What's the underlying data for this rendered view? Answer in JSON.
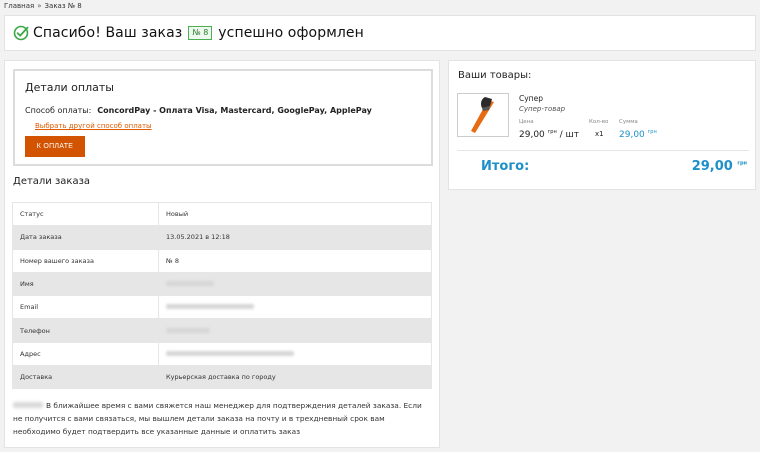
{
  "breadcrumb": {
    "home": "Главная",
    "current": "Заказ № 8"
  },
  "header": {
    "prefix": "Спасибо! Ваш заказ",
    "badge": "№ 8",
    "suffix": "успешно оформлен"
  },
  "payment": {
    "title": "Детали оплаты",
    "method_label": "Способ оплаты:",
    "method_value": "ConcordPay - Оплата Visa, Mastercard, GooglePay, ApplePay",
    "change_link": "Выбрать другой способ оплаты",
    "pay_button": "К ОПЛАТЕ"
  },
  "order": {
    "title": "Детали заказа",
    "rows": [
      {
        "label": "Статус",
        "value": "Новый"
      },
      {
        "label": "Дата заказа",
        "value": "13.05.2021 в 12:18"
      },
      {
        "label": "Номер вашего заказа",
        "value": "№ 8"
      },
      {
        "label": "Имя",
        "value": ""
      },
      {
        "label": "Email",
        "value": ""
      },
      {
        "label": "Телефон",
        "value": ""
      },
      {
        "label": "Адрес",
        "value": ""
      },
      {
        "label": "Доставка",
        "value": "Курьерская доставка по городу"
      }
    ]
  },
  "note": {
    "text": "В ближайшее время с вами свяжется наш менеджер для подтверждения деталей заказа. Если не получится с вами связаться, мы вышлем детали заказа на почту и в трехдневный срок вам необходимо будет подтвердить все указанные данные и оплатить заказ"
  },
  "cart": {
    "title": "Ваши товары:",
    "product": {
      "name": "Супер",
      "subtitle": "Супер-товар",
      "price_label": "Цена",
      "qty_label": "Кол-во",
      "sum_label": "Сумма",
      "price": "29,00",
      "currency": "грн",
      "per_unit": "/ шт",
      "qty": "x1",
      "sum": "29,00"
    },
    "total_label": "Итого:",
    "total_value": "29,00",
    "total_currency": "грн"
  },
  "colors": {
    "accent": "#d35400",
    "link": "#1e90c8",
    "badge": "#4caf50"
  },
  "icons": {
    "header": "check-circle-icon",
    "product": "axe-icon"
  }
}
